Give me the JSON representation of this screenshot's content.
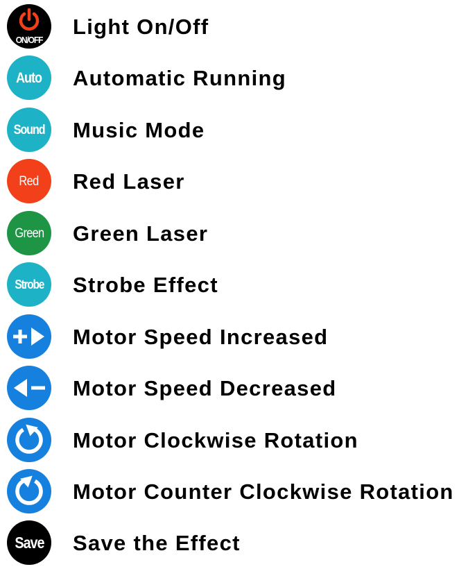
{
  "items": [
    {
      "icon": "power-onoff-icon",
      "badge": "ON/OFF",
      "label": "Light On/Off",
      "color": "#000000"
    },
    {
      "icon": "auto-icon",
      "badge": "Auto",
      "label": "Automatic Running",
      "color": "#1eb2c6"
    },
    {
      "icon": "sound-icon",
      "badge": "Sound",
      "label": "Music Mode",
      "color": "#1eb2c6"
    },
    {
      "icon": "red-icon",
      "badge": "Red",
      "label": "Red Laser",
      "color": "#f2401b"
    },
    {
      "icon": "green-icon",
      "badge": "Green",
      "label": "Green Laser",
      "color": "#1d9545"
    },
    {
      "icon": "strobe-icon",
      "badge": "Strobe",
      "label": "Strobe Effect",
      "color": "#1eb2c6"
    },
    {
      "icon": "speed-increase-icon",
      "badge": "",
      "label": "Motor Speed Increased",
      "color": "#1680df"
    },
    {
      "icon": "speed-decrease-icon",
      "badge": "",
      "label": "Motor Speed Decreased",
      "color": "#1680df"
    },
    {
      "icon": "clockwise-rotation-icon",
      "badge": "",
      "label": "Motor Clockwise Rotation",
      "color": "#1680df"
    },
    {
      "icon": "counter-clockwise-rotation-icon",
      "badge": "",
      "label": "Motor Counter Clockwise Rotation",
      "color": "#1680df"
    },
    {
      "icon": "save-icon",
      "badge": "Save",
      "label": "Save the Effect",
      "color": "#000000"
    }
  ]
}
